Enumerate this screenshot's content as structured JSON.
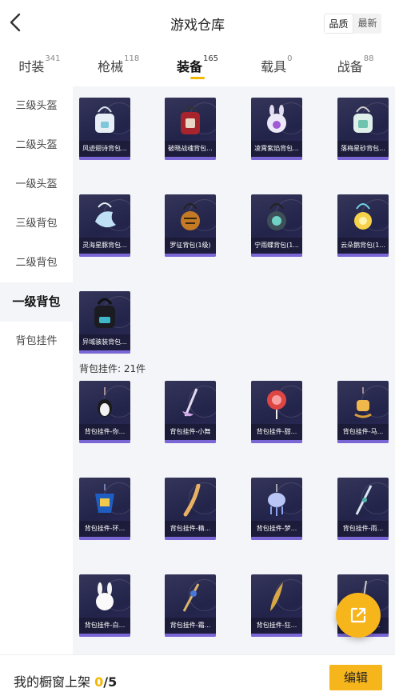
{
  "header": {
    "title": "游戏仓库",
    "sort_options": [
      "品质",
      "最新"
    ],
    "sort_active_index": 0
  },
  "tabs": [
    {
      "label": "时装",
      "count": "341",
      "active": false
    },
    {
      "label": "枪械",
      "count": "118",
      "active": false
    },
    {
      "label": "装备",
      "count": "165",
      "active": true
    },
    {
      "label": "载具",
      "count": "0",
      "active": false
    },
    {
      "label": "战备",
      "count": "88",
      "active": false
    }
  ],
  "sidebar": {
    "items": [
      "三级头盔",
      "二级头盔",
      "一级头盔",
      "三级背包",
      "二级背包",
      "一级背包",
      "背包挂件"
    ],
    "active_index": 5
  },
  "backpacks": [
    {
      "name": "风迹翅诗背包...",
      "icon": "white-backpack-icon"
    },
    {
      "name": "破晓战魂背包...",
      "icon": "red-backpack-icon"
    },
    {
      "name": "凌霄紫焰背包...",
      "icon": "purple-bunny-backpack-icon"
    },
    {
      "name": "落梅星砂背包...",
      "icon": "green-backpack-icon"
    },
    {
      "name": "灵海星豚背包...",
      "icon": "dolphin-backpack-icon"
    },
    {
      "name": "罗征背包(1级)",
      "icon": "tiger-backpack-icon"
    },
    {
      "name": "宁雨蝶背包(1...",
      "icon": "butterfly-backpack-icon"
    },
    {
      "name": "云朵鹅背包(1...",
      "icon": "flower-backpack-icon"
    },
    {
      "name": "异域骇装背包...",
      "icon": "black-backpack-icon"
    }
  ],
  "pendant_section": {
    "label": "背包挂件: 21件"
  },
  "pendants": [
    {
      "name": "背包挂件-你...",
      "icon": "penguin-pendant-icon"
    },
    {
      "name": "背包挂件-小舞",
      "icon": "ribbon-pendant-icon"
    },
    {
      "name": "背包挂件-甜...",
      "icon": "lollipop-pendant-icon"
    },
    {
      "name": "背包挂件-马...",
      "icon": "rocking-horse-pendant-icon"
    },
    {
      "name": "背包挂件-环...",
      "icon": "armor-pendant-icon"
    },
    {
      "name": "背包挂件-精...",
      "icon": "feather-pendant-icon"
    },
    {
      "name": "背包挂件-梦...",
      "icon": "jellyfish-pendant-icon"
    },
    {
      "name": "背包挂件-雨...",
      "icon": "sword-pendant-icon"
    },
    {
      "name": "背包挂件-白...",
      "icon": "rabbit-pendant-icon"
    },
    {
      "name": "背包挂件-霜...",
      "icon": "staff-pendant-icon"
    },
    {
      "name": "背包挂件-狂...",
      "icon": "blade-pendant-icon"
    },
    {
      "name": "背包挂件-...",
      "icon": "charm-pendant-icon"
    }
  ],
  "bottom_bar": {
    "shelf_label": "我的橱窗上架",
    "shelf_current": "0",
    "shelf_total": "/5",
    "edit_label": "编辑"
  },
  "colors": {
    "accent": "#f7b51c",
    "card_bg": "#2a2a52",
    "card_bar": "#7b66d6"
  }
}
